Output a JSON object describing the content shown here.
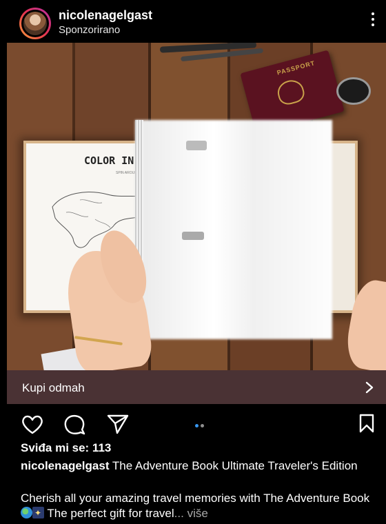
{
  "post": {
    "username": "nicolenagelgast",
    "sponsored": "Sponzorirano",
    "cta_label": "Kupi odmah",
    "likes_text": "Sviđa mi se: 113",
    "caption_user": "nicolenagelgast",
    "caption_text": " The Adventure Book Ultimate Traveler's Edition",
    "description_pre": "Cherish all your amazing travel memories with The Adventure Book ",
    "description_post": " The perfect gift for travel",
    "more_label": "... više",
    "media_page_title": "COLOR IN",
    "media_page_subtitle": "SPIN AROUND",
    "passport_text": "PASSPORT",
    "carousel": {
      "count": 2,
      "active": 1
    }
  },
  "colors": {
    "background": "#000000",
    "cta_bar": "#4a3234",
    "carousel_active": "#3897f0",
    "carousel_inactive": "#8e8e8e"
  },
  "icons": [
    "avatar",
    "more-options-icon",
    "chevron-right-icon",
    "heart-icon",
    "comment-icon",
    "share-icon",
    "bookmark-icon",
    "globe-emoji",
    "stars-emoji"
  ]
}
